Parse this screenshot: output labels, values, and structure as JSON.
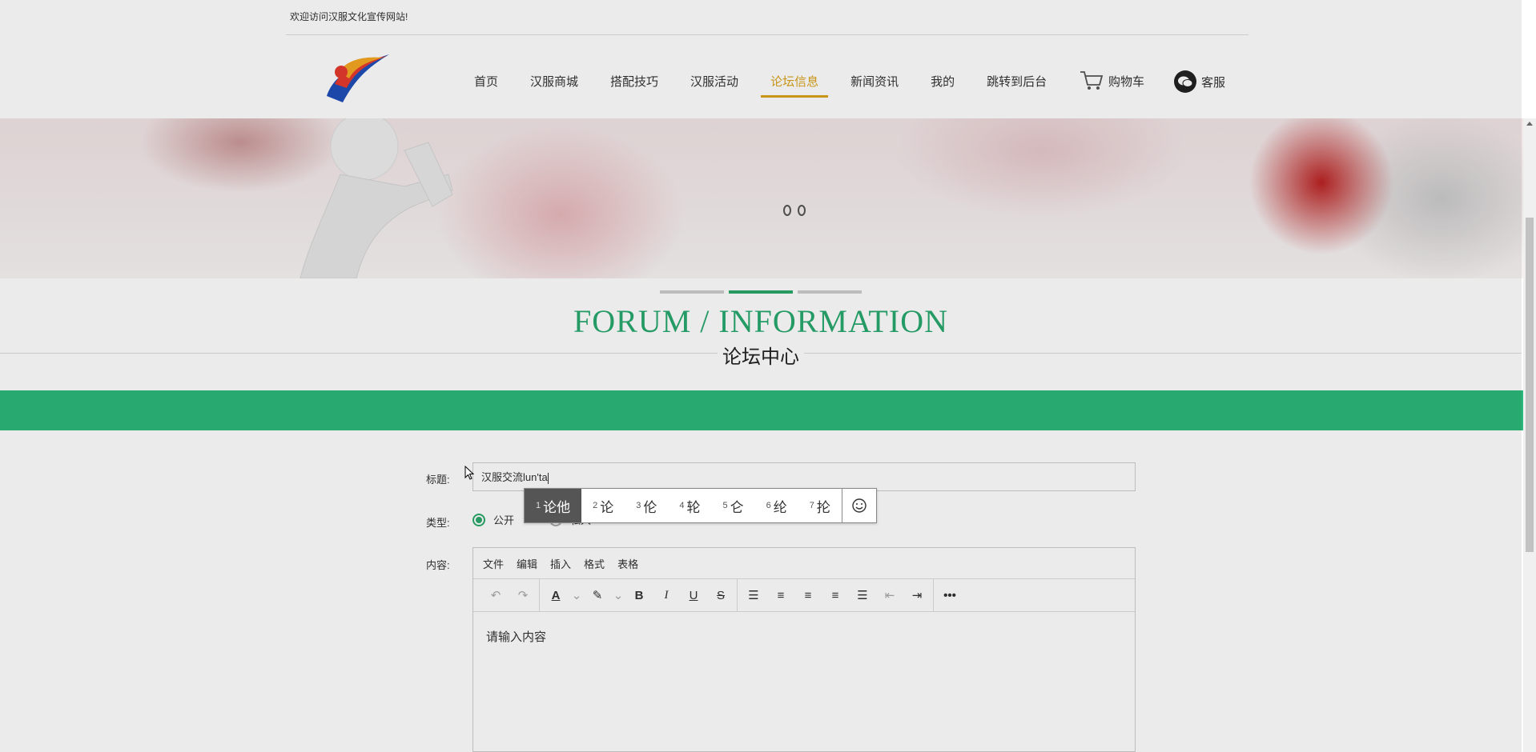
{
  "topbar": {
    "welcome": "欢迎访问汉服文化宣传网站!"
  },
  "nav": {
    "items": [
      {
        "label": "首页",
        "active": false
      },
      {
        "label": "汉服商城",
        "active": false
      },
      {
        "label": "搭配技巧",
        "active": false
      },
      {
        "label": "汉服活动",
        "active": false
      },
      {
        "label": "论坛信息",
        "active": true
      },
      {
        "label": "新闻资讯",
        "active": false
      },
      {
        "label": "我的",
        "active": false
      },
      {
        "label": "跳转到后台",
        "active": false
      }
    ],
    "cart_label": "购物车",
    "service_label": "客服"
  },
  "section": {
    "title_en": "FORUM / INFORMATION",
    "title_cn": "论坛中心"
  },
  "form": {
    "title_label": "标题:",
    "title_value": "汉服交流lun'ta",
    "type_label": "类型:",
    "type_options": [
      "公开",
      "私人"
    ],
    "type_selected": "公开",
    "content_label": "内容:"
  },
  "ime": {
    "candidates": [
      {
        "index": "1",
        "text": "论他"
      },
      {
        "index": "2",
        "text": "论"
      },
      {
        "index": "3",
        "text": "伦"
      },
      {
        "index": "4",
        "text": "轮"
      },
      {
        "index": "5",
        "text": "仑"
      },
      {
        "index": "6",
        "text": "纶"
      },
      {
        "index": "7",
        "text": "抡"
      }
    ],
    "selected_index": "1"
  },
  "editor": {
    "menus": [
      "文件",
      "编辑",
      "插入",
      "格式",
      "表格"
    ],
    "placeholder": "请输入内容"
  },
  "colors": {
    "accent_green": "#2bb87a",
    "nav_active": "#d9a21b"
  }
}
